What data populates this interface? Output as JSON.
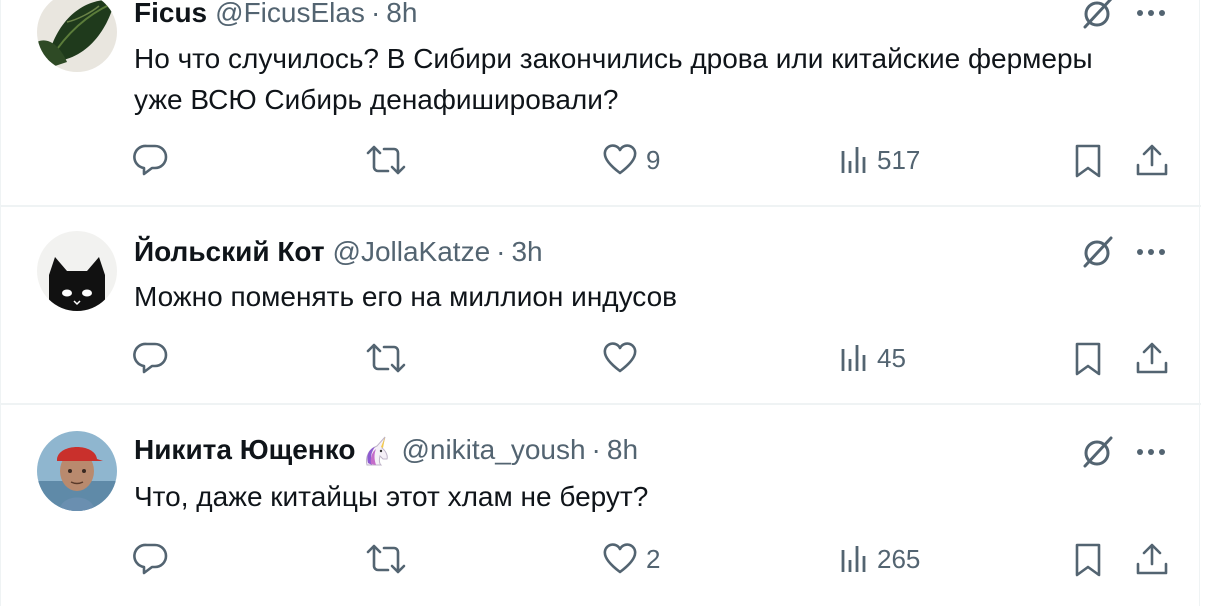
{
  "colors": {
    "muted": "#536471",
    "text": "#0f1419",
    "border": "#eff3f4"
  },
  "tweets": [
    {
      "name": "Ficus",
      "handle": "@FicusElas",
      "dot": "·",
      "time": "8h",
      "text": "Но что случилось? В Сибири закончились дрова или китайские фермеры уже ВСЮ Сибирь денафишировали?",
      "likes": "9",
      "views": "517",
      "avatar_icon": "plant-leaf"
    },
    {
      "name": "Йольский Кот",
      "handle": "@JollaKatze",
      "dot": "·",
      "time": "3h",
      "text": "Можно поменять его на миллион индусов",
      "likes": "",
      "views": "45",
      "avatar_icon": "black-cat"
    },
    {
      "name": "Никита Ющенко",
      "name_emoji": "unicorn",
      "handle": "@nikita_yoush",
      "dot": "·",
      "time": "8h",
      "text": "Что, даже китайцы этот хлам не берут?",
      "likes": "2",
      "views": "265",
      "avatar_icon": "man-in-red-cap"
    }
  ]
}
